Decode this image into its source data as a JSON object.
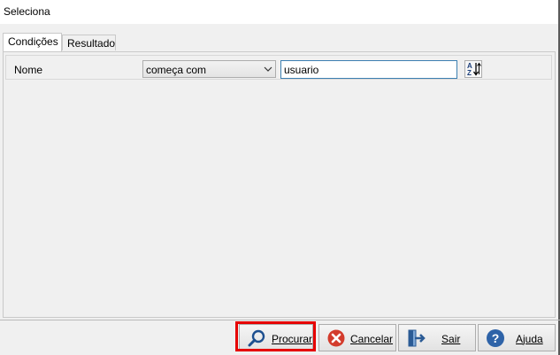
{
  "window": {
    "title": "Seleciona"
  },
  "tabs": [
    {
      "label": "Condições",
      "active": true
    },
    {
      "label": "Resultado",
      "active": false
    }
  ],
  "condition": {
    "field_label": "Nome",
    "operator": "começa com",
    "value": "usuario"
  },
  "buttons": {
    "procurar": {
      "first": "P",
      "rest": "rocurar"
    },
    "cancelar": {
      "first": "C",
      "rest": "ancelar"
    },
    "sair": {
      "first": "S",
      "rest": "air"
    },
    "ajuda": {
      "first": "A",
      "rest": "juda"
    }
  },
  "icons": {
    "procurar": "magnifier-icon",
    "cancelar": "cancel-x-icon",
    "sair": "exit-door-icon",
    "ajuda": "help-question-icon",
    "sort": "sort-az-icon",
    "dropdown": "chevron-down-icon"
  },
  "colors": {
    "highlight": "#e60000",
    "cancel": "#d33b2c",
    "help": "#2e63a8",
    "magnifier": "#1d4f8f"
  }
}
